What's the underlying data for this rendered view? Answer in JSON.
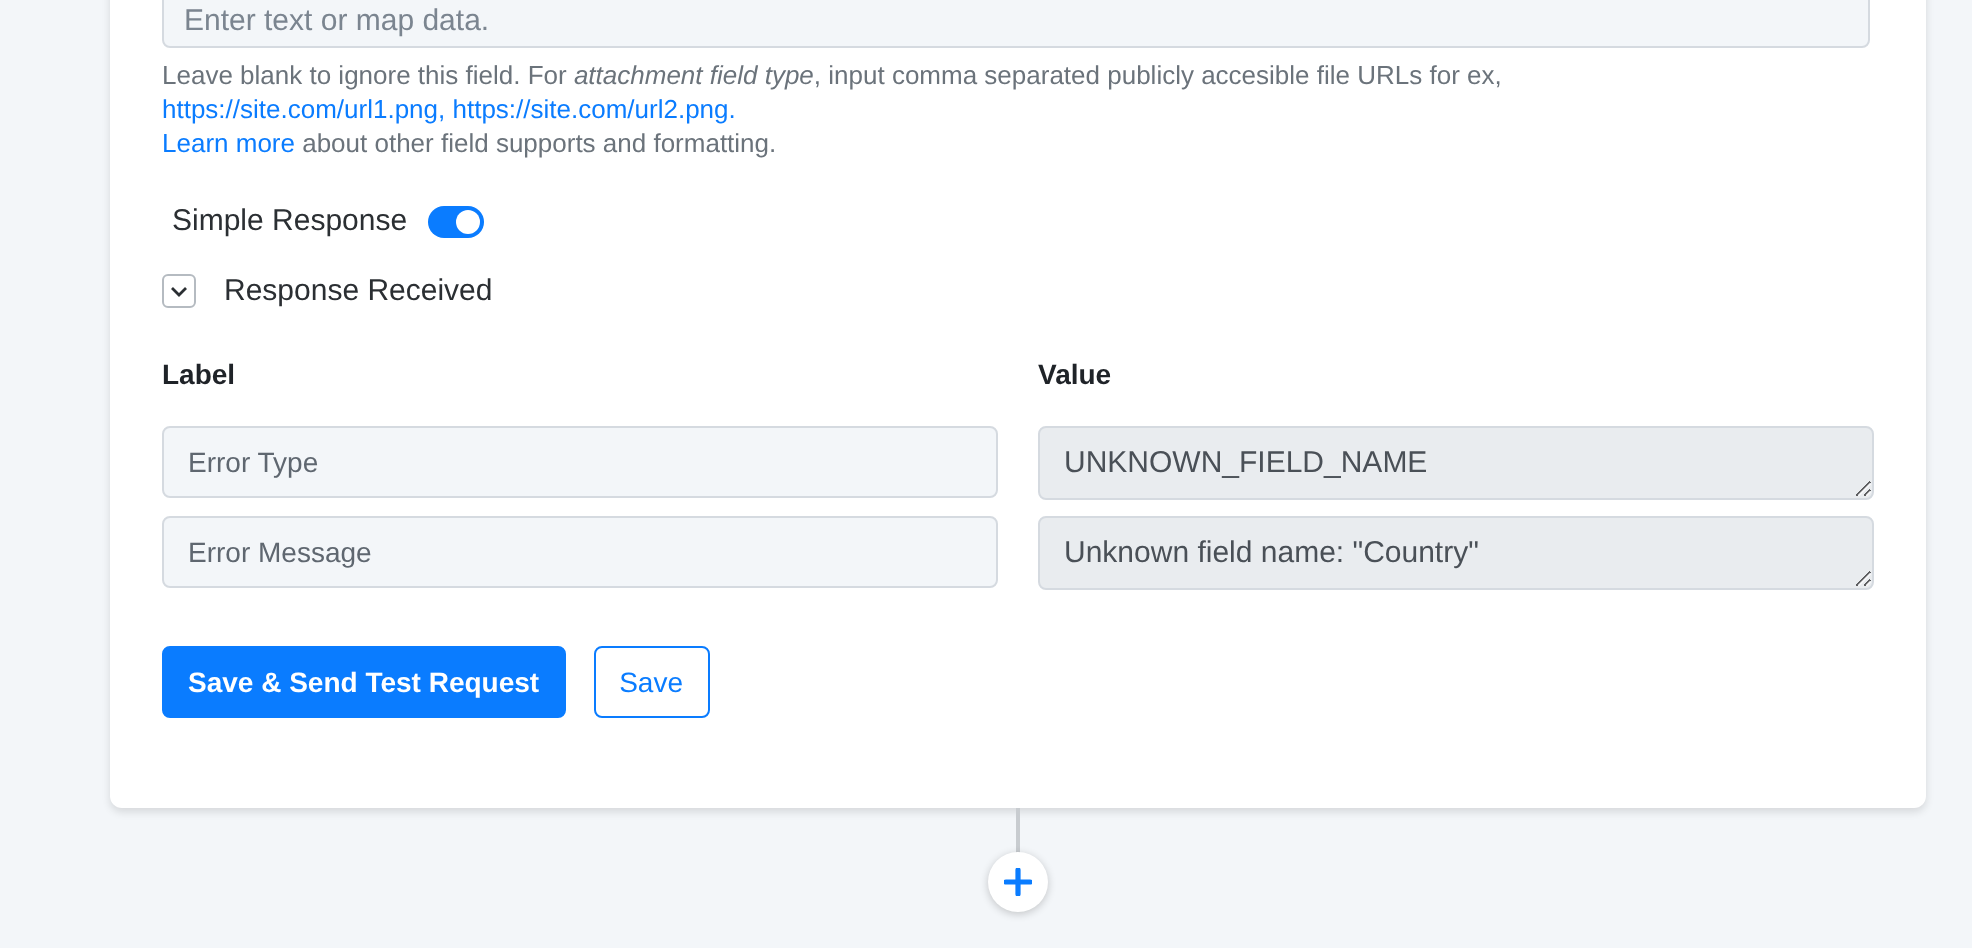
{
  "data_field": {
    "placeholder": "Enter text or map data."
  },
  "help": {
    "text": "Leave blank to ignore this field. For *attachment field type*, input comma separated publicly accesible file URLs for ex,",
    "links": [
      "https://site.com/url1.png,",
      "https://site.com/url2.png."
    ],
    "learn_more": "Learn more",
    "learn_more_rest": " about other field supports and formatting."
  },
  "simple_response": {
    "label": "Simple Response",
    "on": true
  },
  "response_received": {
    "label": "Response Received",
    "expanded": true
  },
  "columns": [
    "Label",
    "Value"
  ],
  "rows": [
    {
      "label": "Error Type",
      "value": "UNKNOWN_FIELD_NAME"
    },
    {
      "label": "Error Message",
      "value": "Unknown field name: \"Country\""
    }
  ],
  "buttons": [
    {
      "label": "Save & Send Test Request",
      "kind": "primary"
    },
    {
      "label": "Save",
      "kind": "outline"
    }
  ]
}
